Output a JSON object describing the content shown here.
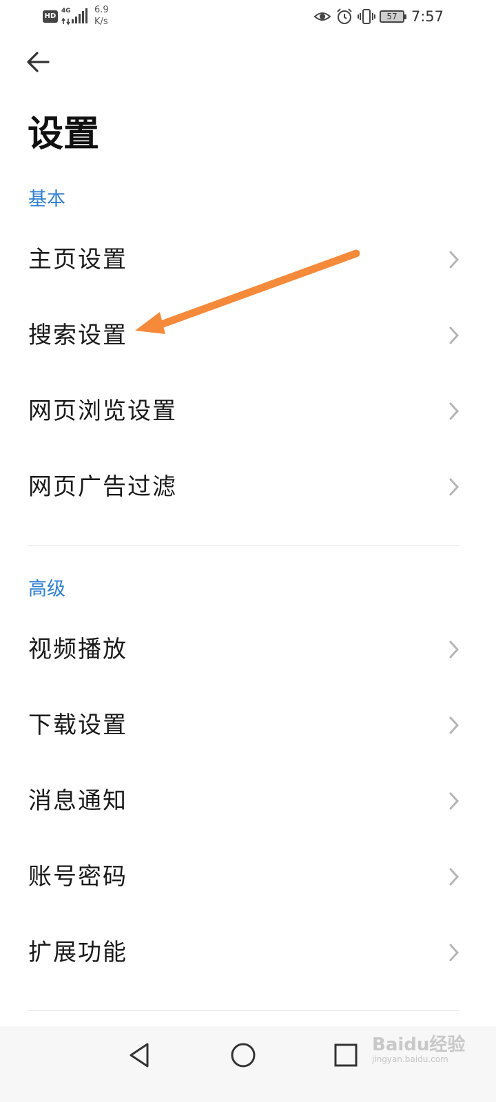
{
  "status_bar": {
    "hd": "HD",
    "network": "4G",
    "speed_value": "6.9",
    "speed_unit": "K/s",
    "battery": "57",
    "time": "7:57"
  },
  "page": {
    "title": "设置"
  },
  "sections": [
    {
      "label": "基本",
      "items": [
        "主页设置",
        "搜索设置",
        "网页浏览设置",
        "网页广告过滤"
      ]
    },
    {
      "label": "高级",
      "items": [
        "视频播放",
        "下载设置",
        "消息通知",
        "账号密码",
        "扩展功能"
      ]
    }
  ],
  "watermark": {
    "brand": "Baidu经验",
    "url": "jingyan.baidu.com"
  },
  "colors": {
    "accent": "#2f7fd1",
    "annotation_arrow": "#f58a3a"
  }
}
